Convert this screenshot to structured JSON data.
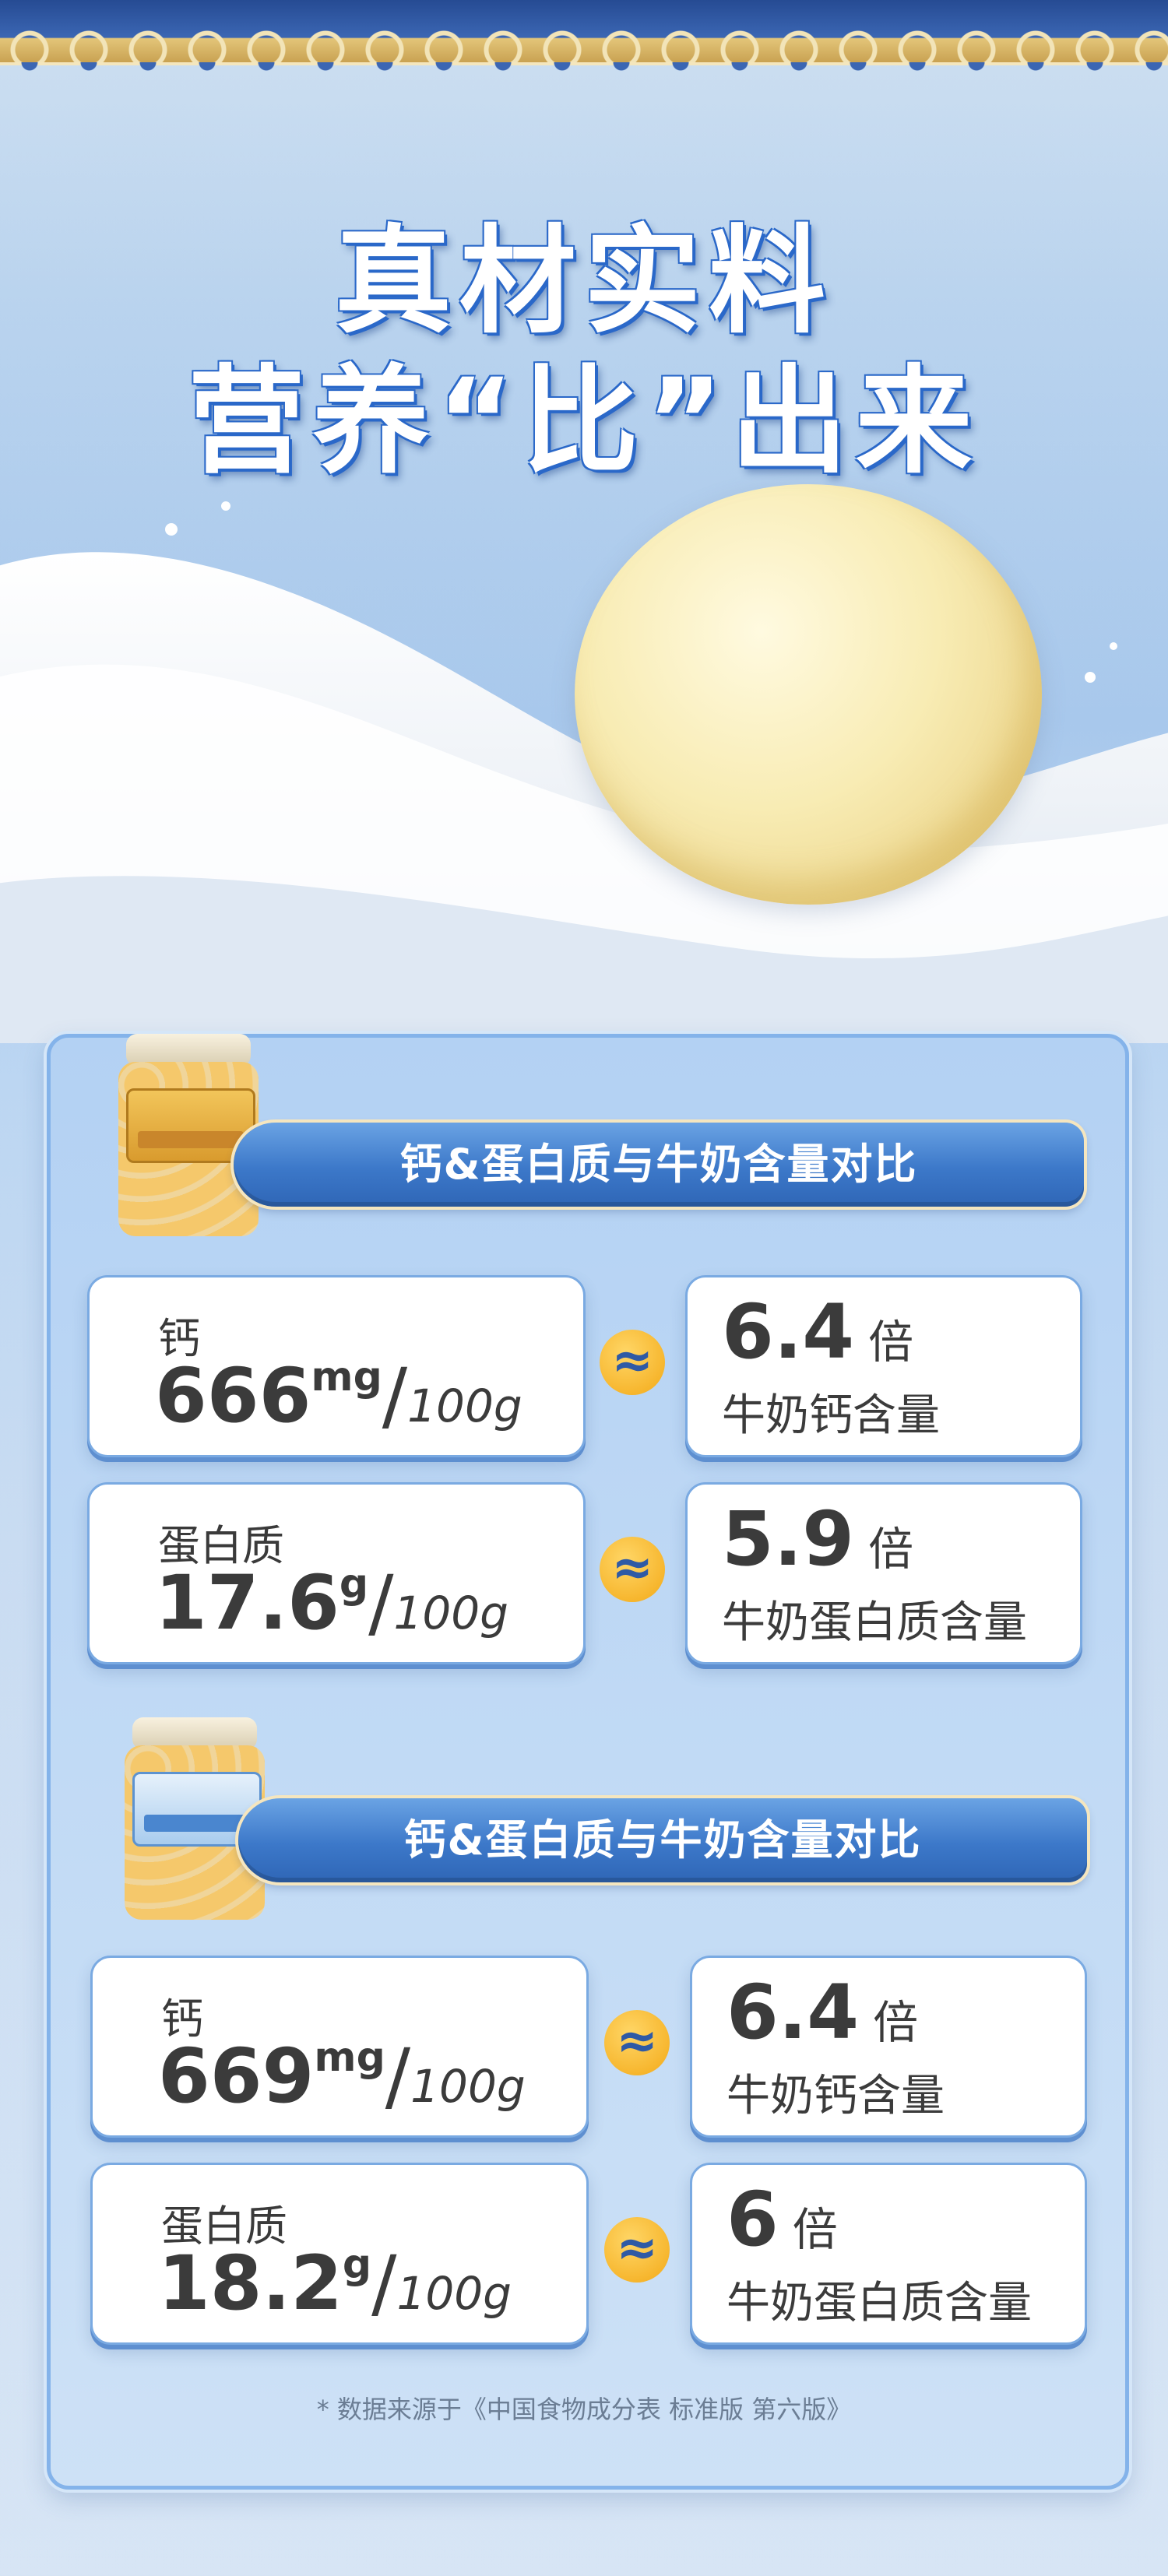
{
  "title": {
    "line1": "真材实料",
    "line2": "营养“比”出来"
  },
  "sections": [
    {
      "header": "钙&蛋白质与牛奶含量对比",
      "rows": [
        {
          "label": "钙",
          "value": "666",
          "unit": "mg",
          "per": "100g",
          "approx": "≈",
          "multiple": "6.4",
          "times": "倍",
          "compare": "牛奶钙含量"
        },
        {
          "label": "蛋白质",
          "value": "17.6",
          "unit": "g",
          "per": "100g",
          "approx": "≈",
          "multiple": "5.9",
          "times": "倍",
          "compare": "牛奶蛋白质含量"
        }
      ]
    },
    {
      "header": "钙&蛋白质与牛奶含量对比",
      "rows": [
        {
          "label": "钙",
          "value": "669",
          "unit": "mg",
          "per": "100g",
          "approx": "≈",
          "multiple": "6.4",
          "times": "倍",
          "compare": "牛奶钙含量"
        },
        {
          "label": "蛋白质",
          "value": "18.2",
          "unit": "g",
          "per": "100g",
          "approx": "≈",
          "multiple": "6",
          "times": "倍",
          "compare": "牛奶蛋白质含量"
        }
      ]
    }
  ],
  "footnote": "* 数据来源于《中国食物成分表 标准版 第六版》",
  "colors": {
    "accent": "#3c78c9",
    "badge": "#f3a917",
    "panel": "#c1daf5"
  }
}
